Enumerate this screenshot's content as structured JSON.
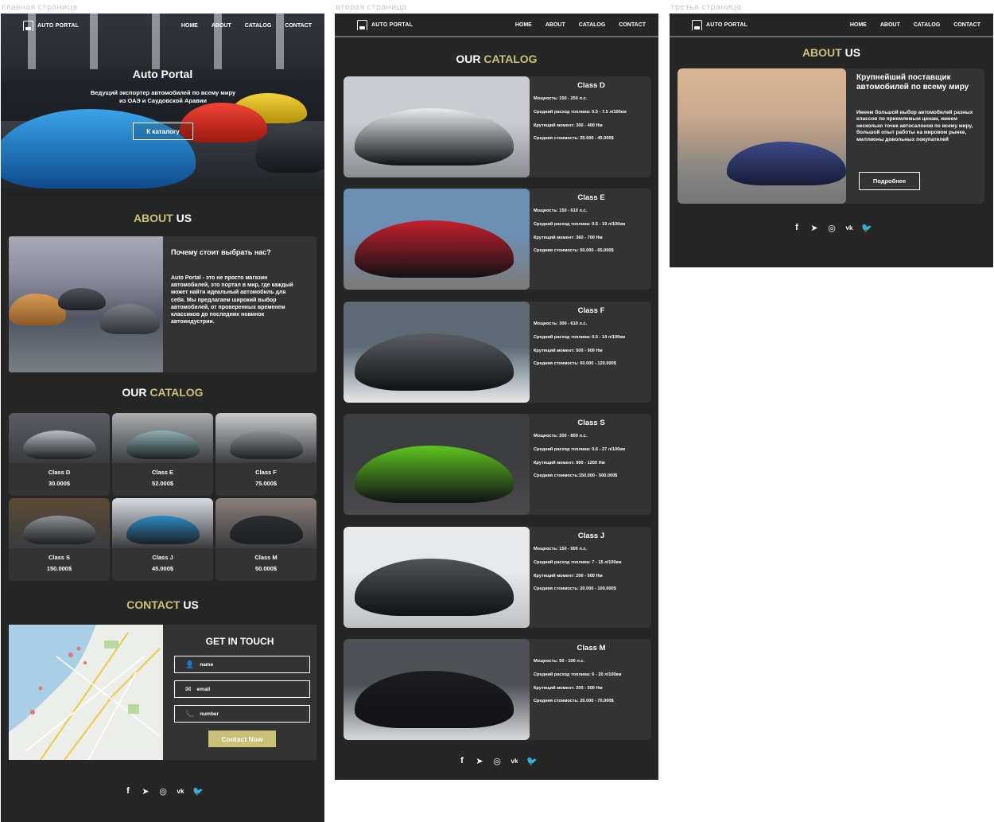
{
  "frame_labels": [
    "главная страница",
    "вторая страница",
    "третья страница"
  ],
  "nav": {
    "logo": "AUTO PORTAL",
    "items": [
      "HOME",
      "ABOUT",
      "CATALOG",
      "CONTACT"
    ]
  },
  "hero": {
    "title": "Auto Portal",
    "subtitle": "Ведущий экспортер автомобилей по всему миру из ОАЭ и Саудовской Аравии",
    "button": "К каталогу"
  },
  "about": {
    "title_a": "ABOUT",
    "title_b": " US",
    "question": "Почему стоит выбрать нас?",
    "text": "Auto Portal - это не просто магазин автомобилей, это портал в мир, где каждый может найти идеальный автомобиль для себя. Мы предлагаем широкий выбор автомобилей, от проверенных временем классиков до последних новинок автоиндустрии."
  },
  "catalog": {
    "title_a": "OUR",
    "title_b": " CATALOG",
    "items": [
      {
        "name": "Class D",
        "price": "30.000$",
        "color": "#b9bfc6",
        "bg": "#5a5e63"
      },
      {
        "name": "Class E",
        "price": "52.000$",
        "color": "#8fb0b4",
        "bg": "#a8adb0"
      },
      {
        "name": "Class F",
        "price": "75.000$",
        "color": "#8f9396",
        "bg": "#c9cacb"
      },
      {
        "name": "Class S",
        "price": "150.000$",
        "color": "#8d9196",
        "bg": "#5b4a33"
      },
      {
        "name": "Class J",
        "price": "45.000$",
        "color": "#2a8bc4",
        "bg": "#d8dde3"
      },
      {
        "name": "Class M",
        "price": "50.000$",
        "color": "#2b2d30",
        "bg": "#8a7f77"
      }
    ]
  },
  "contact": {
    "title_a": "CONTACT",
    "title_b": " US",
    "form_title": "GET IN TOUCH",
    "name_placeholder": "name",
    "email_placeholder": "email",
    "number_placeholder": "number",
    "button": "Contact Now"
  },
  "classes": [
    {
      "title": "Class D",
      "power": "Мощность:  150 - 250 л.с.",
      "fuel": "Средний расход топлива: 0.5 - 7.5 л/100км",
      "torque": "Крутящий момент: 300 - 400 Нм",
      "cost": "Средняя стоимость:  25.000 - 45.000$",
      "car": "#e8eaec",
      "bg1": "#c9ccd0",
      "bg2": "#8a8e93"
    },
    {
      "title": "Class E",
      "power": "Мощность:  150 - 610 л.с.",
      "fuel": "Средний расход топлива: 0.5 - 19 л/100км",
      "torque": "Крутящий момент: 360 - 700 Нм",
      "cost": "Средняя стоимость:  50.000 - 65.000$",
      "car": "#c51f2e",
      "bg1": "#6d8fb3",
      "bg2": "#7c7a77"
    },
    {
      "title": "Class F",
      "power": "Мощность:  300 - 610 л.с.",
      "fuel": "Средний расход топлива: 0.5 - 14 л/100км",
      "torque": "Крутящий момент: 500 - 900 Нм",
      "cost": "Средняя стоимость: 60.000 - 120.000$",
      "car": "#5a5d63",
      "bg1": "#5d6a74",
      "bg2": "#e6e9ec"
    },
    {
      "title": "Class S",
      "power": "Мощность:  200 - 800 л.с.",
      "fuel": "Средний расход топлива: 0.6 - 27 л/100км",
      "torque": "Крутящий момент: 900 - 1200 Нм",
      "cost": "Средняя стоимость:150.000 - 500.000$",
      "car": "#5fc421",
      "bg1": "#3c3d3f",
      "bg2": "#4a4b4d"
    },
    {
      "title": "Class J",
      "power": "Мощность:  150 - 500 л.с.",
      "fuel": "Средний расход топлива: 7 - 15 л/100км",
      "torque": "Крутящий момент: 200 - 500 Нм",
      "cost": "Средняя стоимость:  20.000 - 100.000$",
      "car": "#505356",
      "bg1": "#e7e8ea",
      "bg2": "#bfc1c4"
    },
    {
      "title": "Class M",
      "power": "Мощность:  50 - 100 л.с.",
      "fuel": "Средний расход топлива: 6 - 20 л/100км",
      "torque": "Крутящий момент: 200 - 500 Нм",
      "cost": "Средняя стоимость:  20.000 - 70.000$",
      "car": "#1c1d1f",
      "bg1": "#4d5055",
      "bg2": "#d7d9db"
    }
  ],
  "about3": {
    "title": "Крупнейший поставщик автомобилей по всему миру",
    "text": "Имеем большой выбор автомобилей разных классов по приемлемым ценам, имеем несколько точек автосалонов по всему миру, большой опыт работы на мировом рынке, миллионы довольных покупателей",
    "button": "Подробнее"
  },
  "social_icons": [
    "facebook-icon",
    "telegram-icon",
    "instagram-icon",
    "vk-icon",
    "twitter-icon"
  ],
  "social_glyphs": [
    "f",
    "➤",
    "◎",
    "vk",
    "🐦"
  ],
  "colors": {
    "accent": "#c9c178",
    "background": "#262626",
    "card": "#333333"
  }
}
